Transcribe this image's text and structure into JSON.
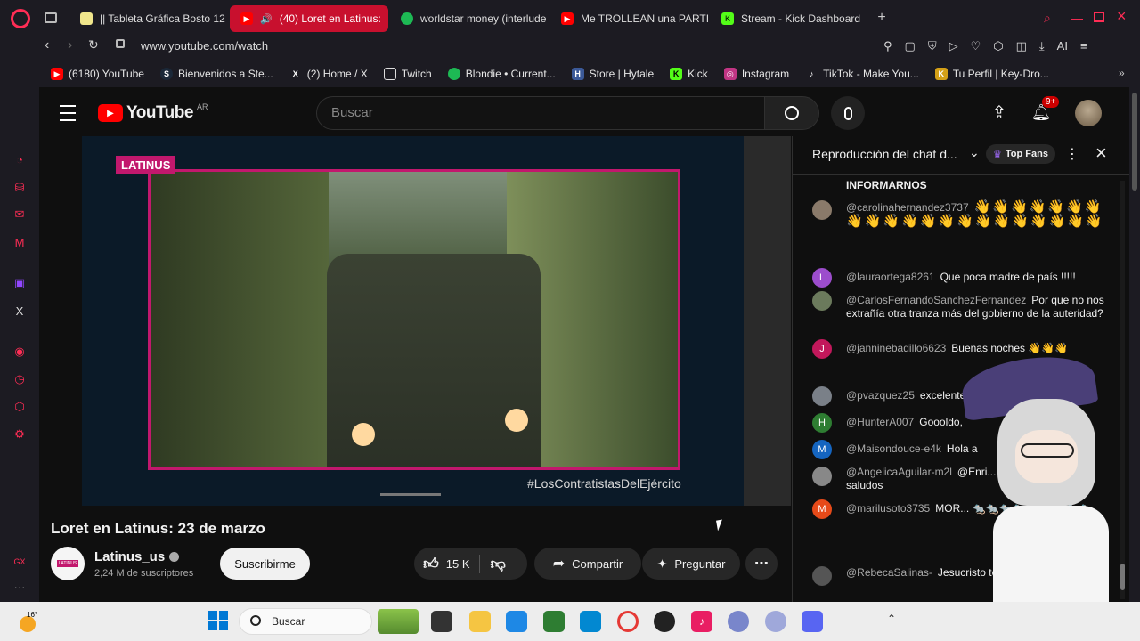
{
  "browser": {
    "tabs": [
      {
        "label": "|| Tableta Gráfica Bosto 12",
        "color": "#f0e68c"
      },
      {
        "label": "(40) Loret en Latinus:",
        "color": "#ff0000",
        "active": true
      },
      {
        "label": "worldstar money (interlude",
        "color": "#1db954"
      },
      {
        "label": "Me TROLLEAN una PARTI",
        "color": "#ff0000"
      },
      {
        "label": "Stream - Kick Dashboard",
        "color": "#53fc18"
      }
    ],
    "url": "www.youtube.com/watch",
    "ai_label": "AI",
    "bookmarks": [
      {
        "label": "(6180) YouTube",
        "color": "#ff0000",
        "glyph": "▶"
      },
      {
        "label": "Bienvenidos a Ste...",
        "color": "#1b2838",
        "glyph": "S"
      },
      {
        "label": "(2) Home / X",
        "color": "#000000",
        "glyph": "X"
      },
      {
        "label": "Twitch",
        "color": "#000000",
        "glyph": "I"
      },
      {
        "label": "Blondie • Current...",
        "color": "#1db954",
        "glyph": "●"
      },
      {
        "label": "Store | Hytale",
        "color": "#3b5998",
        "glyph": "H"
      },
      {
        "label": "Kick",
        "color": "#53fc18",
        "glyph": "K"
      },
      {
        "label": "Instagram",
        "color": "#c13584",
        "glyph": "◎"
      },
      {
        "label": "TikTok - Make You...",
        "color": "#000000",
        "glyph": "♪"
      },
      {
        "label": "Tu Perfil | Key-Dro...",
        "color": "#d4a017",
        "glyph": "K"
      }
    ]
  },
  "youtube": {
    "logo": "YouTube",
    "region": "AR",
    "search_placeholder": "Buscar",
    "notifications": "9+",
    "video": {
      "badge": "LATINUS",
      "hashtag": "#LosContratistasDelEjército",
      "title": "Loret en Latinus: 23 de marzo"
    },
    "channel": {
      "name": "Latinus_us",
      "avatar_text": "LATINUS",
      "subscribers": "2,24 M de suscriptores",
      "subscribe_label": "Suscribirme"
    },
    "actions": {
      "likes": "15 K",
      "share": "Compartir",
      "ask": "Preguntar"
    },
    "chat": {
      "header": "Reproducción del chat d...",
      "top_fans": "Top Fans",
      "messages": [
        {
          "author": "",
          "text": "INFORMARNOS",
          "avatar": "",
          "color": "#0f0f0f"
        },
        {
          "author": "@carolinahernandez3737",
          "text": "👋👋👋👋👋👋👋👋👋👋👋👋👋👋👋👋👋👋👋👋👋",
          "avatar": "",
          "color": "#8a7a6a"
        },
        {
          "author": "@lauraortega8261",
          "text": "Que poca madre de país !!!!!",
          "avatar": "L",
          "color": "#9c4dcc"
        },
        {
          "author": "@CarlosFernandoSanchezFernandez",
          "text": "Por que no nos extrañía otra tranza más del gobierno de la auteridad?",
          "avatar": "",
          "color": "#6b7a5c"
        },
        {
          "author": "@janninebadillo6623",
          "text": "Buenas noches 👋👋👋",
          "avatar": "J",
          "color": "#c2185b"
        },
        {
          "author": "@pvazquez25",
          "text": "excelente ...25",
          "avatar": "",
          "color": "#7a8088"
        },
        {
          "author": "@HunterA007",
          "text": "Goooldo,",
          "avatar": "H",
          "color": "#2e7d32"
        },
        {
          "author": "@Maisondouce-e4k",
          "text": "Hola a",
          "avatar": "M",
          "color": "#1565c0"
        },
        {
          "author": "@AngelicaAguilar-m2l",
          "text": "@Enri... kas, Jaime Torres... saludos",
          "avatar": "",
          "color": "#888888"
        },
        {
          "author": "@marilusoto3735",
          "text": "MOR... 🐀🐀🐀🐀🐀🐀🐀🐀🐀",
          "avatar": "M",
          "color": "#e64a19"
        },
        {
          "author": "@RebecaSalinas-",
          "text": "Jesucristo te be...",
          "avatar": "",
          "color": "#555555"
        }
      ]
    }
  },
  "taskbar": {
    "search_placeholder": "Buscar",
    "weather": "16°"
  }
}
